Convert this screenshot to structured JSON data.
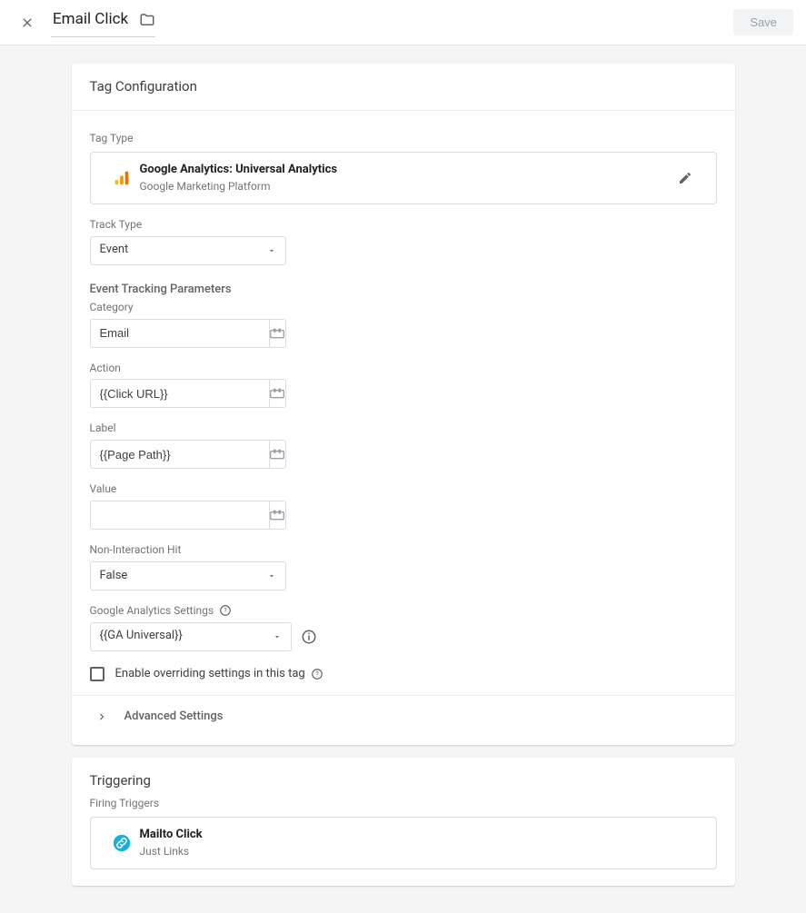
{
  "header": {
    "title": "Email Click",
    "save_label": "Save"
  },
  "tag_config": {
    "heading": "Tag Configuration",
    "tag_type_label": "Tag Type",
    "tag_type": {
      "name": "Google Analytics: Universal Analytics",
      "platform": "Google Marketing Platform"
    },
    "track_type_label": "Track Type",
    "track_type_value": "Event",
    "params_heading": "Event Tracking Parameters",
    "category_label": "Category",
    "category_value": "Email",
    "action_label": "Action",
    "action_value": "{{Click URL}}",
    "label_label": "Label",
    "label_value": "{{Page Path}}",
    "value_label": "Value",
    "value_value": "",
    "non_interaction_label": "Non-Interaction Hit",
    "non_interaction_value": "False",
    "ga_settings_label": "Google Analytics Settings",
    "ga_settings_value": "{{GA Universal}}",
    "override_label": "Enable overriding settings in this tag",
    "advanced_label": "Advanced Settings"
  },
  "triggering": {
    "heading": "Triggering",
    "firing_label": "Firing Triggers",
    "trigger": {
      "name": "Mailto Click",
      "type": "Just Links"
    }
  }
}
